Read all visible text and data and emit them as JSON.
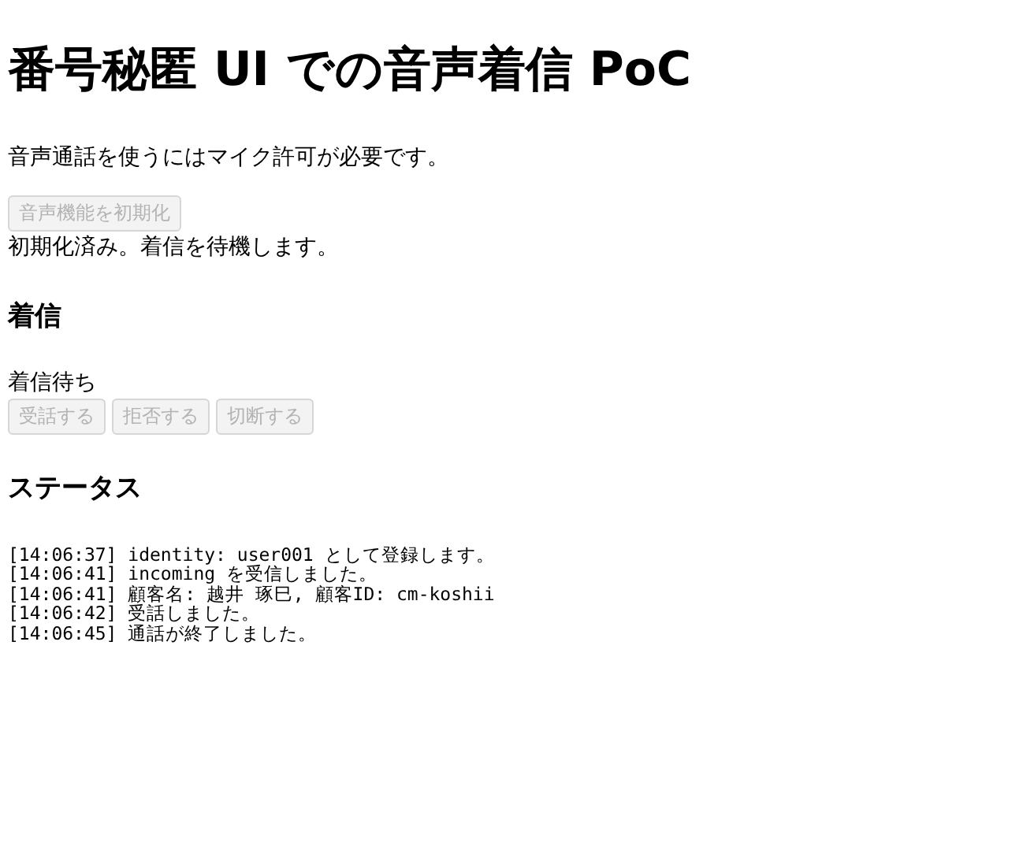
{
  "title": "番号秘匿 UI での音声着信 PoC",
  "intro": "音声通話を使うにはマイク許可が必要です。",
  "init_button": {
    "label": "音声機能を初期化",
    "disabled": true
  },
  "init_status": "初期化済み。着信を待機します。",
  "incoming": {
    "heading": "着信",
    "status": "着信待ち",
    "buttons": [
      {
        "label": "受話する",
        "disabled": true
      },
      {
        "label": "拒否する",
        "disabled": true
      },
      {
        "label": "切断する",
        "disabled": true
      }
    ]
  },
  "status": {
    "heading": "ステータス",
    "log": [
      "[14:06:37] identity: user001 として登録します。",
      "[14:06:41] incoming を受信しました。",
      "[14:06:41] 顧客名: 越井 琢巳, 顧客ID: cm-koshii",
      "[14:06:42] 受話しました。",
      "[14:06:45] 通話が終了しました。"
    ]
  }
}
